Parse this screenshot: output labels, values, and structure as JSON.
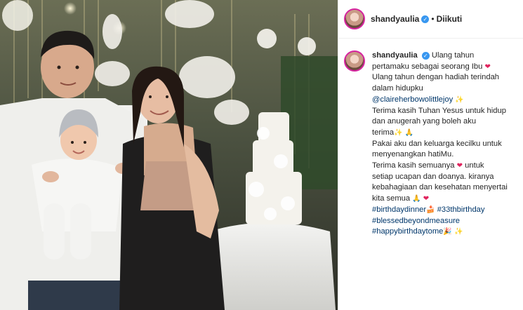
{
  "header": {
    "username": "shandyaulia",
    "separator": "•",
    "follow_status": "Diikuti",
    "verified_mark": "✓"
  },
  "caption": {
    "username": "shandyaulia",
    "lines": {
      "l1a": "Ulang tahun",
      "l2a": "pertamaku sebagai seorang Ibu",
      "l3": "Ulang tahun dengan hadiah terindah",
      "l4": "dalam hidupku",
      "mention": "@claireherbowolittlejoy",
      "l6": "Terima kasih Tuhan Yesus untuk hidup",
      "l7": "dan anugerah yang boleh aku",
      "l8": "terima",
      "l9": "Pakai aku dan keluarga kecilku untuk",
      "l10": "menyenangkan hatiMu.",
      "l11a": "Terima kasih semuanya",
      "l11b": "untuk",
      "l12": "setiap ucapan dan doanya. kiranya",
      "l13": "kebahagiaan dan kesehatan menyertai",
      "l14": "kita semua"
    },
    "hashtags": {
      "h1": "#birthdaydinner",
      "h2": "#33thbirthday",
      "h3": "#blessedbeyondmeasure",
      "h4": "#happybirthdaytome"
    },
    "emojis": {
      "heart": "❤",
      "sparkles": "✨",
      "pray": "🙏",
      "cake": "🍰",
      "party": "🎉"
    }
  },
  "colors": {
    "accent_link": "#00376b",
    "verified_blue": "#3897f0",
    "heart_red": "#e0245e",
    "story_ring": "#d6249f"
  }
}
